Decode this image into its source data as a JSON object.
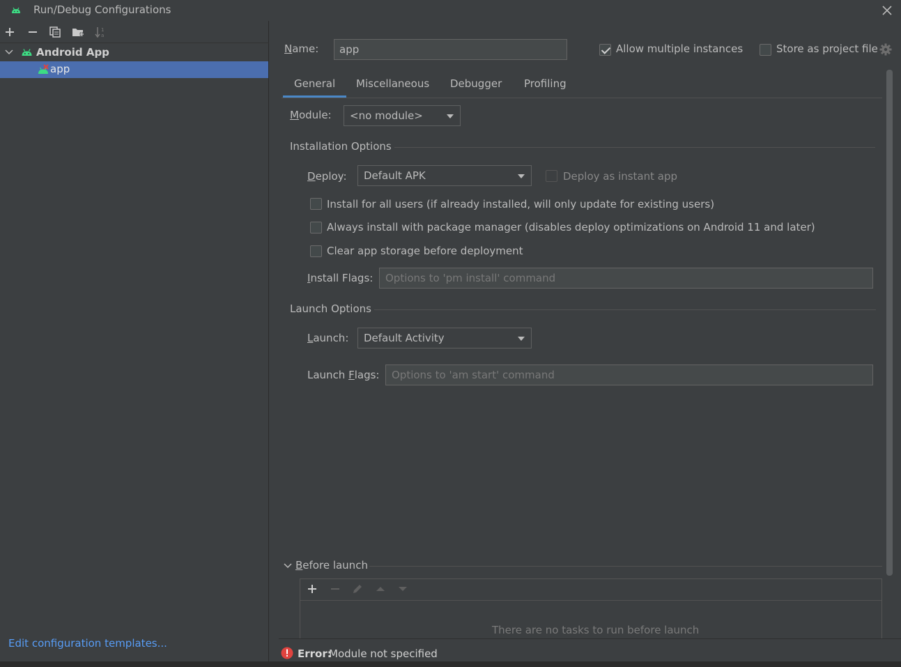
{
  "window": {
    "title": "Run/Debug Configurations",
    "icon": "android-icon",
    "close_icon": "close-icon"
  },
  "left_toolbar": {
    "icons": [
      "add-icon",
      "remove-icon",
      "copy-icon",
      "new-folder-icon",
      "sort-icon"
    ]
  },
  "tree": {
    "group_label": "Android App",
    "item_label": "app"
  },
  "left_footer": {
    "edit_templates_label": "Edit configuration templates..."
  },
  "config": {
    "name_label_mnemonic": "N",
    "name_label_rest": "ame:",
    "name_value": "app",
    "allow_multiple_label": "Allow multiple instances",
    "allow_multiple_checked": true,
    "store_project_label": "Store as project file",
    "store_project_checked": false
  },
  "tabs": [
    {
      "label": "General",
      "active": true
    },
    {
      "label": "Miscellaneous",
      "active": false
    },
    {
      "label": "Debugger",
      "active": false
    },
    {
      "label": "Profiling",
      "active": false
    }
  ],
  "general": {
    "module_label_mnemonic": "M",
    "module_label_rest": "odule:",
    "module_value": "<no module>",
    "installation_title": "Installation Options",
    "deploy_label_mnemonic": "D",
    "deploy_label_rest": "eploy:",
    "deploy_value": "Default APK",
    "instant_label": "Deploy as instant app",
    "install_all_users_label": "Install for all users (if already installed, will only update for existing users)",
    "always_pkg_mgr_label": "Always install with package manager (disables deploy optimizations on Android 11 and later)",
    "clear_storage_label": "Clear app storage before deployment",
    "install_flags_label_mnemonic": "I",
    "install_flags_label_rest": "nstall Flags:",
    "install_flags_placeholder": "Options to 'pm install' command",
    "launch_title": "Launch Options",
    "launch_label_mnemonic": "L",
    "launch_label_rest": "aunch:",
    "launch_value": "Default Activity",
    "launch_flags_label_pre": "Launch ",
    "launch_flags_label_mnemonic": "F",
    "launch_flags_label_rest": "lags:",
    "launch_flags_placeholder": "Options to 'am start' command"
  },
  "before_launch": {
    "title_mnemonic": "B",
    "title_rest": "efore launch",
    "empty_text": "There are no tasks to run before launch",
    "toolbar_icons": [
      "add-icon",
      "remove-icon",
      "edit-icon",
      "move-up-icon",
      "move-down-icon"
    ]
  },
  "status": {
    "error_label": "Error:",
    "error_message": "Module not specified"
  },
  "colors": {
    "background": "#3c3f41",
    "selection": "#4b6eaf",
    "link": "#589df6",
    "android_green": "#3ddc84",
    "error_red": "#e0433f"
  }
}
